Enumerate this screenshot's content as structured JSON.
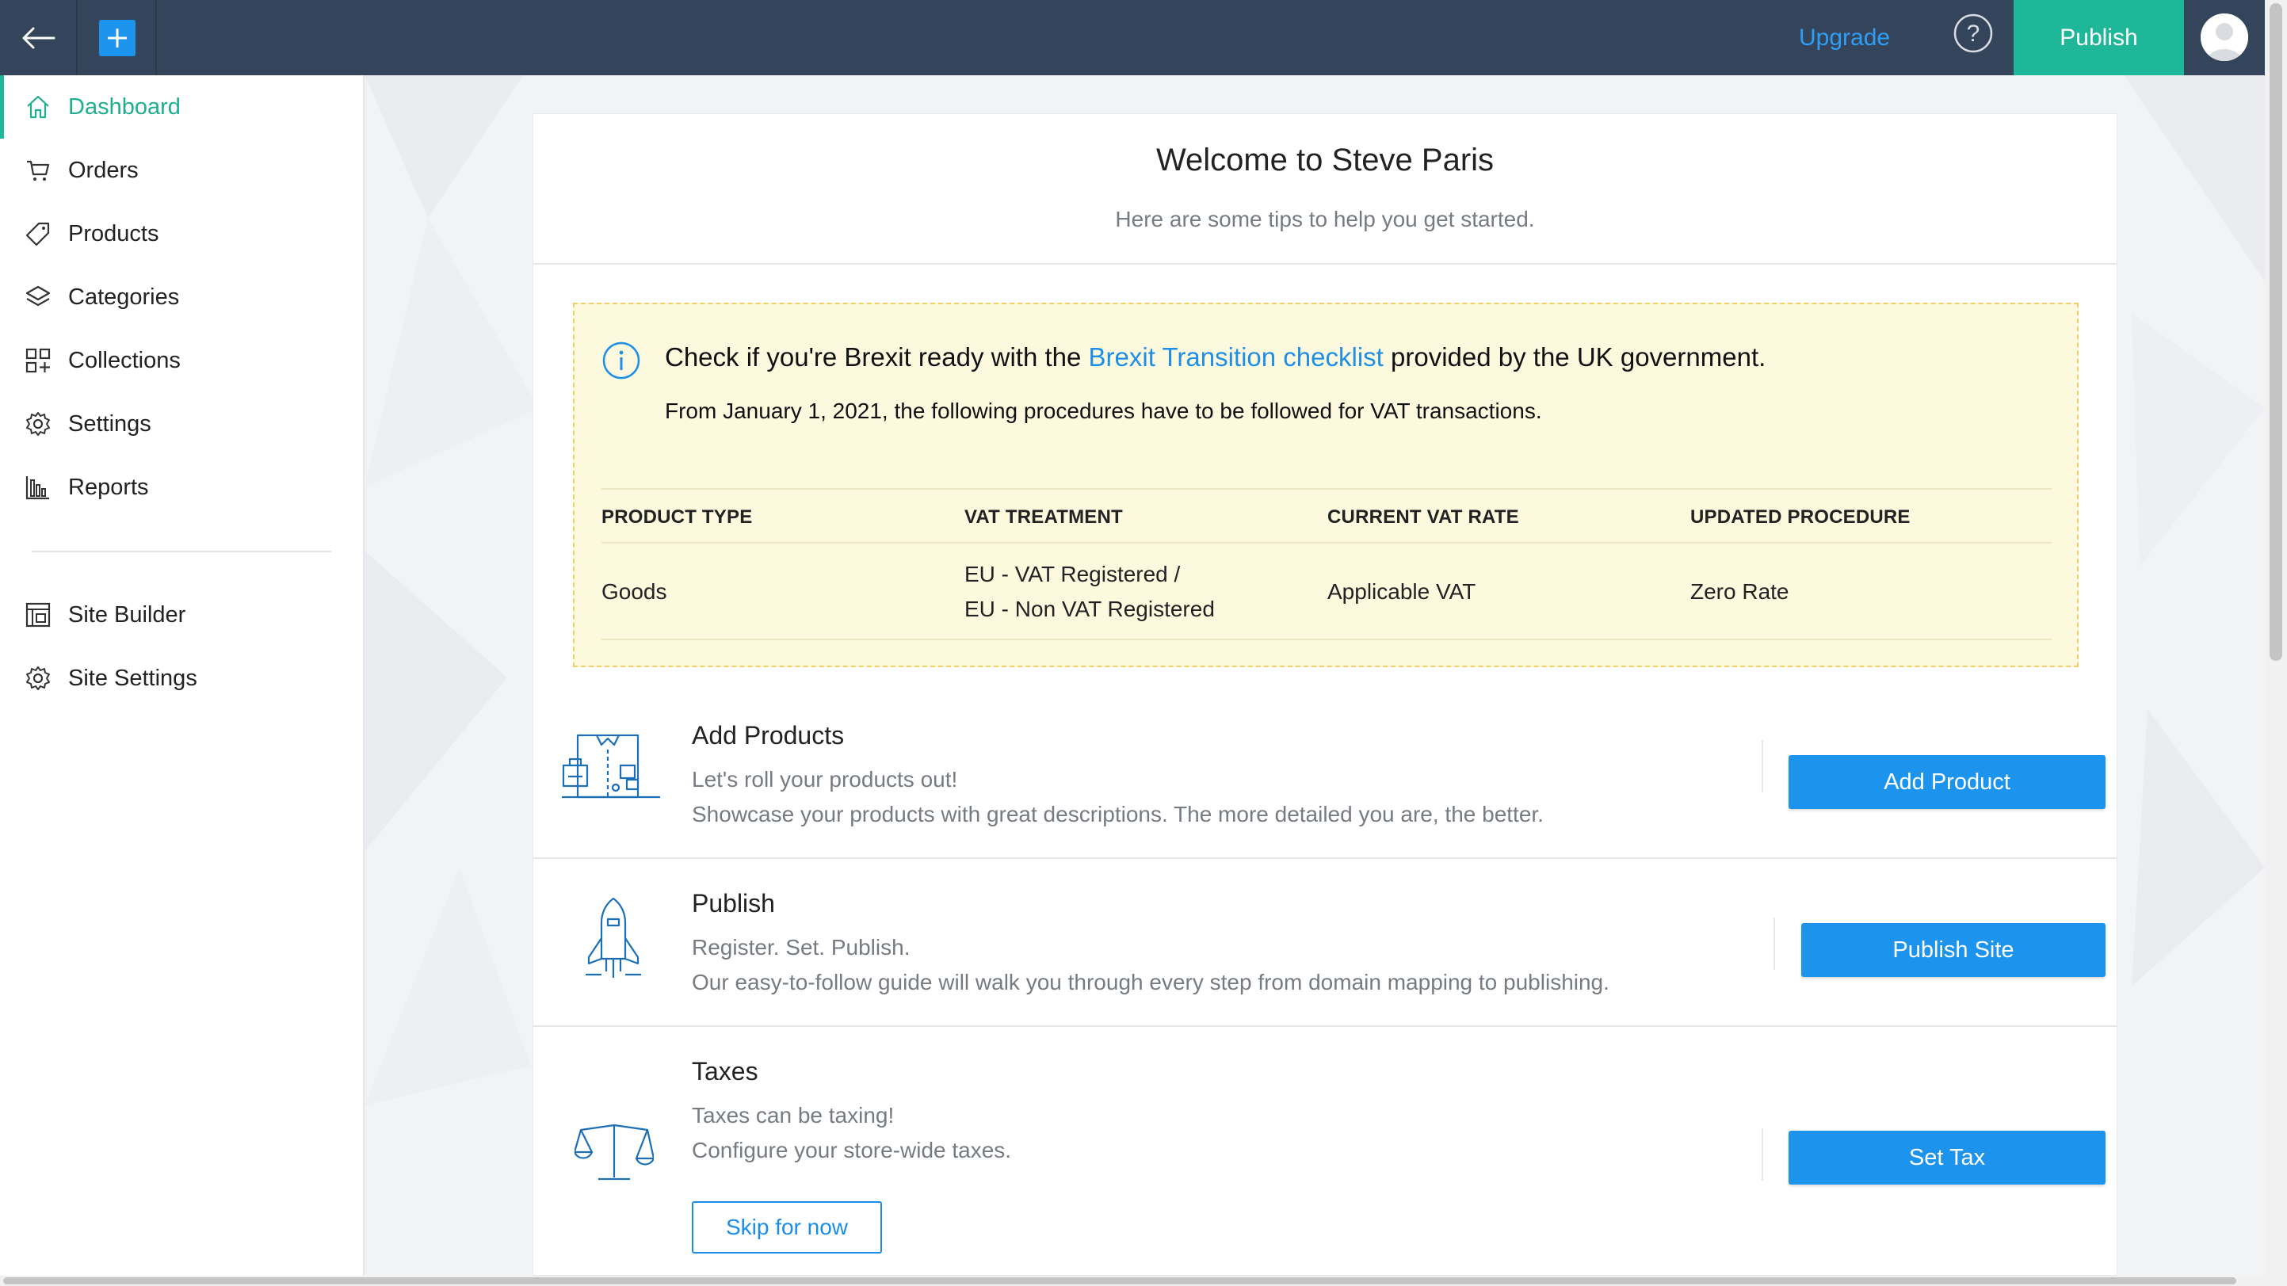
{
  "topbar": {
    "back_icon": "arrow-left-icon",
    "add_icon": "plus-icon",
    "upgrade_label": "Upgrade",
    "help_icon": "question-circle-icon",
    "publish_label": "Publish",
    "avatar_icon": "user-avatar-icon"
  },
  "sidebar": {
    "items": [
      {
        "label": "Dashboard",
        "icon": "home-icon",
        "active": true
      },
      {
        "label": "Orders",
        "icon": "cart-icon"
      },
      {
        "label": "Products",
        "icon": "tag-icon"
      },
      {
        "label": "Categories",
        "icon": "layers-icon"
      },
      {
        "label": "Collections",
        "icon": "grid-plus-icon"
      },
      {
        "label": "Settings",
        "icon": "gear-icon"
      },
      {
        "label": "Reports",
        "icon": "bar-chart-icon"
      }
    ],
    "items2": [
      {
        "label": "Site Builder",
        "icon": "site-builder-icon"
      },
      {
        "label": "Site Settings",
        "icon": "gear-icon"
      }
    ]
  },
  "main": {
    "title": "Welcome to Steve Paris",
    "subtitle": "Here are some tips to help you get started.",
    "brexit": {
      "text_before": "Check if you're Brexit ready with the ",
      "link": "Brexit Transition checklist",
      "text_after": " provided by the UK government.",
      "line2": "From January 1, 2021, the following procedures have to be followed for VAT transactions.",
      "headers": [
        "PRODUCT TYPE",
        "VAT TREATMENT",
        "CURRENT VAT RATE",
        "UPDATED PROCEDURE"
      ],
      "row": {
        "product_type": "Goods",
        "vat_treatment_1": "EU - VAT Registered /",
        "vat_treatment_2": "EU - Non VAT Registered",
        "current_rate": "Applicable VAT",
        "updated_procedure": "Zero Rate"
      }
    },
    "tips": [
      {
        "title": "Add Products",
        "line1": "Let's roll your products out!",
        "line2": "Showcase your products with great descriptions. The more detailed you are, the better.",
        "button": "Add Product",
        "icon": "products-illustration-icon"
      },
      {
        "title": "Publish",
        "line1": "Register. Set. Publish.",
        "line2": "Our easy-to-follow guide will walk you through every step from domain mapping to publishing.",
        "button": "Publish Site",
        "icon": "rocket-illustration-icon"
      },
      {
        "title": "Taxes",
        "line1": "Taxes can be taxing!",
        "line2": "Configure your store-wide taxes.",
        "button": "Set Tax",
        "skip_button": "Skip for now",
        "icon": "scales-illustration-icon"
      }
    ]
  },
  "colors": {
    "topbar": "#34445b",
    "accent_green": "#1fb799",
    "primary_blue": "#1c93ec",
    "brexit_bg": "#fdf9de",
    "brexit_border": "#f2cf63"
  }
}
